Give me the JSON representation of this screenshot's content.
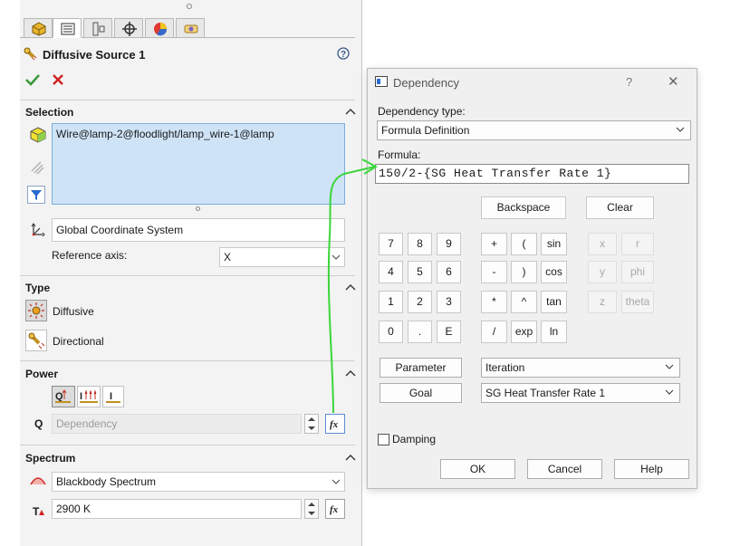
{
  "property_manager": {
    "title": "Diffusive Source 1",
    "tabs": [
      "feature-manager-tab",
      "property-manager-tab",
      "configuration-manager-tab",
      "dimxpert-tab",
      "appearance-tab",
      "display-manager-tab"
    ],
    "selection": {
      "header": "Selection",
      "selected_item": "Wire@lamp-2@floodlight/lamp_wire-1@lamp",
      "coordinate_system": "Global Coordinate System",
      "reference_axis_label": "Reference axis:",
      "reference_axis_value": "X"
    },
    "type": {
      "header": "Type",
      "options": [
        "Diffusive",
        "Directional"
      ]
    },
    "power": {
      "header": "Power",
      "symbol": "Q",
      "value_placeholder": "Dependency"
    },
    "spectrum": {
      "header": "Spectrum",
      "selected": "Blackbody Spectrum",
      "temp_symbol": "T",
      "temperature": "2900 K"
    }
  },
  "dialog": {
    "title": "Dependency",
    "help_glyph": "?",
    "close_glyph": "✕",
    "dependency_type_label": "Dependency type:",
    "dependency_type_value": "Formula Definition",
    "formula_label": "Formula:",
    "formula_value": "150/2-{SG Heat Transfer Rate 1}",
    "backspace": "Backspace",
    "clear": "Clear",
    "digits": [
      [
        "7",
        "8",
        "9"
      ],
      [
        "4",
        "5",
        "6"
      ],
      [
        "1",
        "2",
        "3"
      ],
      [
        "0",
        ".",
        "E"
      ]
    ],
    "operators": [
      [
        "+",
        "(",
        "sin"
      ],
      [
        "-",
        ")",
        "cos"
      ],
      [
        "*",
        "^",
        "tan"
      ],
      [
        "/",
        "exp",
        "ln"
      ]
    ],
    "variables": [
      [
        "x",
        "r"
      ],
      [
        "y",
        "phi"
      ],
      [
        "z",
        "theta"
      ]
    ],
    "parameter_button": "Parameter",
    "parameter_combo": "Iteration",
    "goal_button": "Goal",
    "goal_combo": "SG Heat Transfer Rate 1",
    "damping_label": "Damping",
    "ok": "OK",
    "cancel": "Cancel",
    "help": "Help"
  },
  "colors": {
    "selection_fill": "#cfe3f7",
    "selection_border": "#7aaedc",
    "accept_green": "#3a9a3a",
    "reject_red": "#d02020",
    "annotation_arrow": "#39d639"
  }
}
